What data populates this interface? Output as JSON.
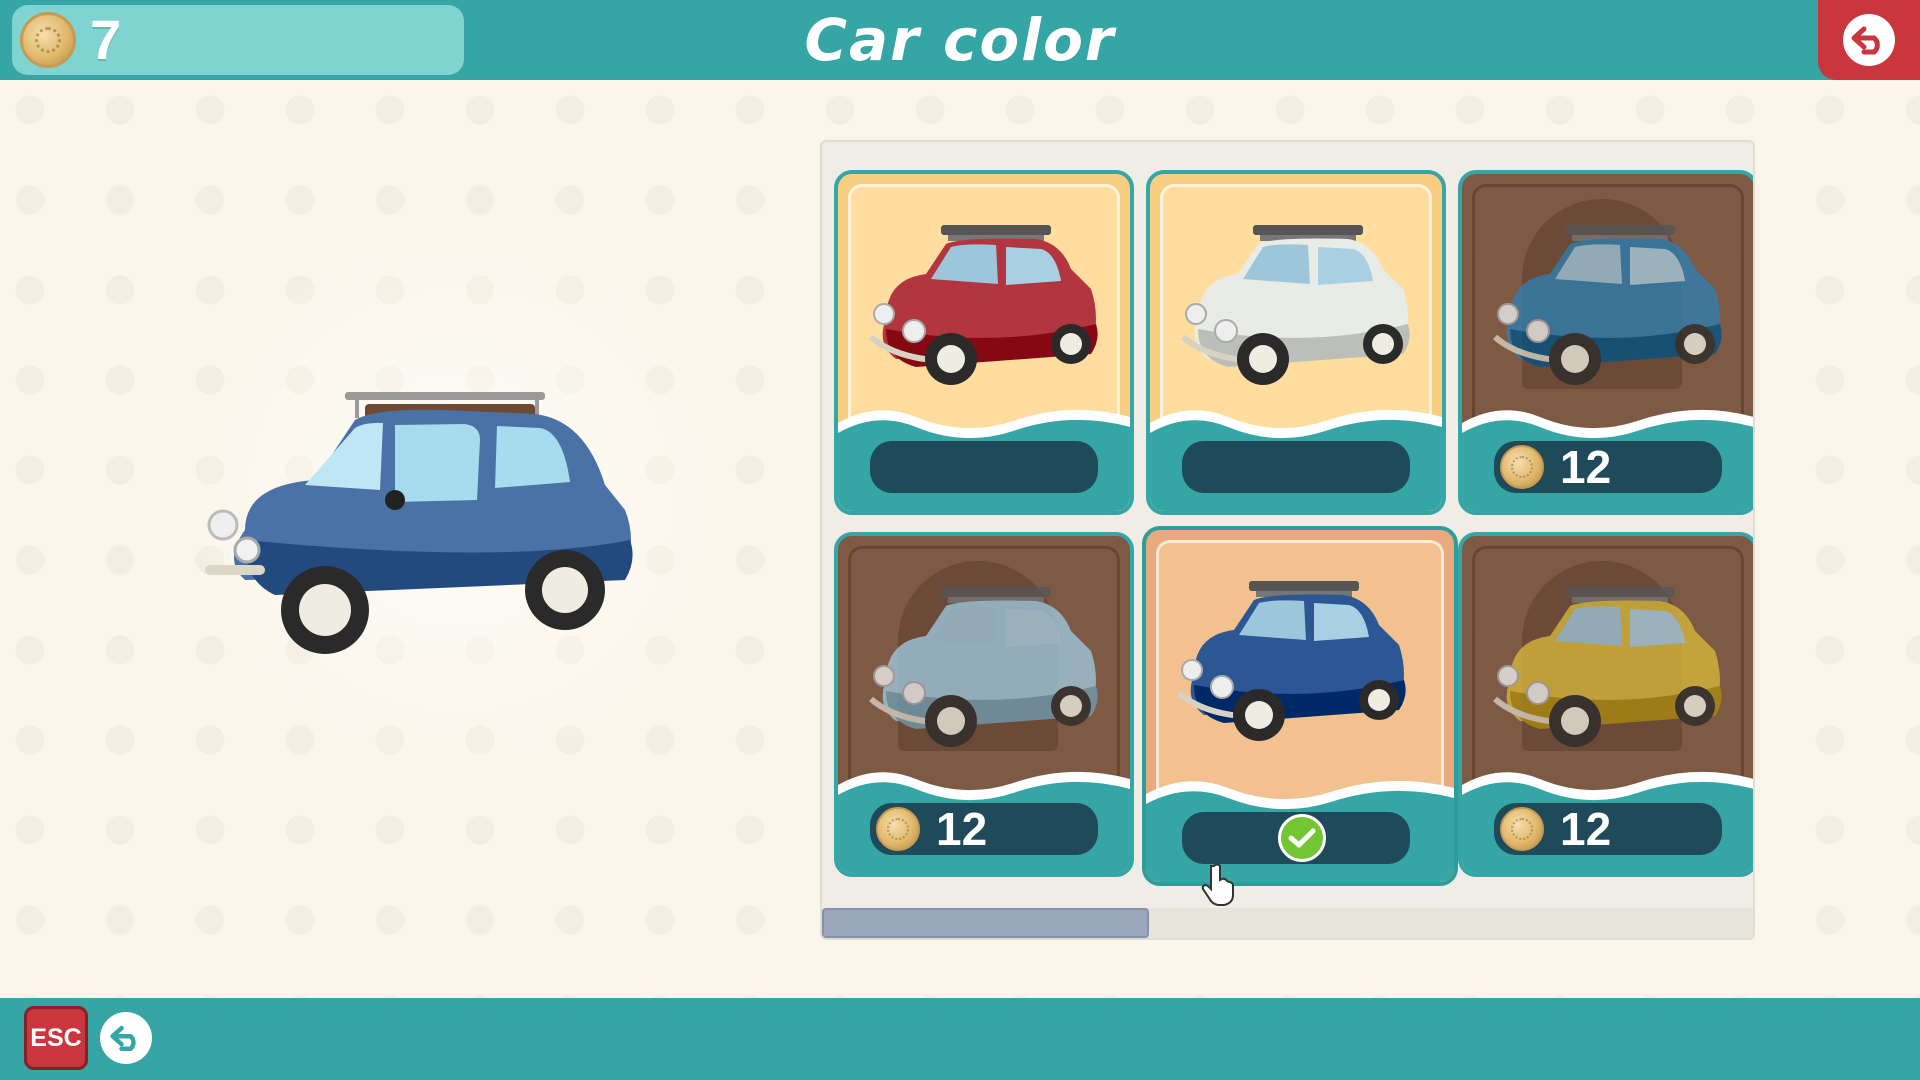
{
  "header": {
    "coins": "7",
    "title": "Car color"
  },
  "colors": {
    "teal": "#36a5a6",
    "teal_light": "#7fd3d0",
    "red_button": "#c9363d",
    "pill": "#1f4a59",
    "check": "#73c531"
  },
  "preview": {
    "car_color": "#4b72a6"
  },
  "cars": [
    {
      "color": "#b3353f",
      "state": "unlocked",
      "price": ""
    },
    {
      "color": "#e9ebe6",
      "state": "unlocked",
      "price": ""
    },
    {
      "color": "#2e7fb2",
      "state": "locked",
      "price": "12"
    },
    {
      "color": "#9ec9de",
      "state": "locked",
      "price": "12"
    },
    {
      "color": "#2c5694",
      "state": "selected",
      "price": ""
    },
    {
      "color": "#d8b83c",
      "state": "locked",
      "price": "12"
    }
  ],
  "scroll": {
    "position": 0.0,
    "visible_fraction": 0.35
  },
  "footer": {
    "esc_label": "ESC",
    "back_icon": "back-arrow-icon"
  }
}
